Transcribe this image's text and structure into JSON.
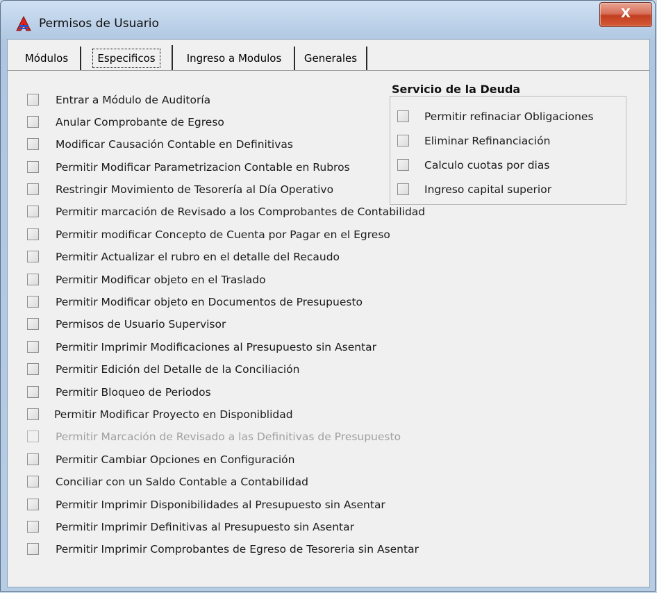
{
  "window": {
    "title": "Permisos de Usuario",
    "close_glyph": "X"
  },
  "tabs": [
    {
      "label": "Módulos"
    },
    {
      "label": "Especificos"
    },
    {
      "label": "Ingreso a Modulos"
    },
    {
      "label": "Generales"
    }
  ],
  "permissions": [
    {
      "label": "Entrar a Módulo de Auditoría",
      "checked": false,
      "enabled": true
    },
    {
      "label": "Anular Comprobante de Egreso",
      "checked": false,
      "enabled": true
    },
    {
      "label": "Modificar Causación Contable en Definitivas",
      "checked": false,
      "enabled": true
    },
    {
      "label": "Permitir Modificar Parametrizacion Contable en Rubros",
      "checked": false,
      "enabled": true
    },
    {
      "label": "Restringir Movimiento de Tesorería al Día Operativo",
      "checked": false,
      "enabled": true
    },
    {
      "label": "Permitir marcación de Revisado a los Comprobantes de Contabilidad",
      "checked": false,
      "enabled": true
    },
    {
      "label": "Permitir modificar Concepto de Cuenta por Pagar en el Egreso",
      "checked": false,
      "enabled": true
    },
    {
      "label": "Permitir Actualizar el rubro en el detalle del Recaudo",
      "checked": false,
      "enabled": true
    },
    {
      "label": "Permitir Modificar objeto en el Traslado",
      "checked": false,
      "enabled": true
    },
    {
      "label": "Permitir Modificar objeto en Documentos de Presupuesto",
      "checked": false,
      "enabled": true
    },
    {
      "label": "Permisos de Usuario Supervisor",
      "checked": false,
      "enabled": true
    },
    {
      "label": "Permitir Imprimir Modificaciones al Presupuesto sin Asentar",
      "checked": false,
      "enabled": true
    },
    {
      "label": "Permitir Edición del Detalle de la Conciliación",
      "checked": false,
      "enabled": true
    },
    {
      "label": "Permitir Bloqueo de Periodos",
      "checked": false,
      "enabled": true
    },
    {
      "label": "Permitir Modificar Proyecto en Disponiblidad",
      "checked": false,
      "enabled": true
    },
    {
      "label": "Permitir Marcación de Revisado a las Definitivas de Presupuesto",
      "checked": false,
      "enabled": false
    },
    {
      "label": "Permitir Cambiar Opciones en Configuración",
      "checked": false,
      "enabled": true
    },
    {
      "label": "Conciliar con un Saldo Contable a Contabilidad",
      "checked": false,
      "enabled": true
    },
    {
      "label": "Permitir Imprimir Disponibilidades al Presupuesto sin Asentar",
      "checked": false,
      "enabled": true
    },
    {
      "label": "Permitir Imprimir Definitivas al Presupuesto sin Asentar",
      "checked": false,
      "enabled": true
    },
    {
      "label": "Permitir Imprimir Comprobantes de Egreso de Tesoreria sin Asentar",
      "checked": false,
      "enabled": true
    }
  ],
  "servicio_deuda": {
    "title": "Servicio de la Deuda",
    "items": [
      {
        "label": "Permitir refinaciar Obligaciones",
        "checked": false
      },
      {
        "label": "Eliminar Refinanciación",
        "checked": false
      },
      {
        "label": "Calculo cuotas por dias",
        "checked": false
      },
      {
        "label": "Ingreso capital superior",
        "checked": false
      }
    ]
  }
}
